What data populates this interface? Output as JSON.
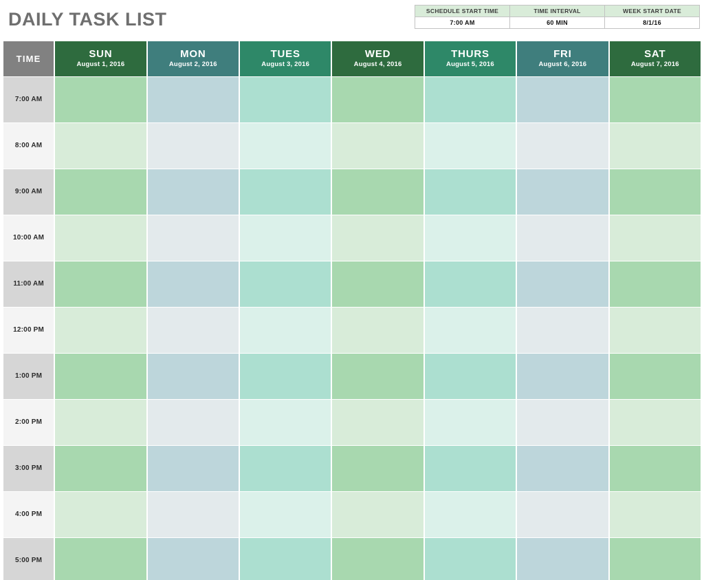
{
  "page_title": "DAILY TASK LIST",
  "settings": {
    "headers": [
      "SCHEDULE START TIME",
      "TIME INTERVAL",
      "WEEK START DATE"
    ],
    "values": [
      "7:00 AM",
      "60 MIN",
      "8/1/16"
    ]
  },
  "grid": {
    "time_header": "TIME",
    "days": [
      {
        "abbr": "SUN",
        "date": "August 1, 2016",
        "theme": "green"
      },
      {
        "abbr": "MON",
        "date": "August 2, 2016",
        "theme": "teal"
      },
      {
        "abbr": "TUES",
        "date": "August 3, 2016",
        "theme": "emerald"
      },
      {
        "abbr": "WED",
        "date": "August 4, 2016",
        "theme": "green"
      },
      {
        "abbr": "THURS",
        "date": "August 5, 2016",
        "theme": "emerald"
      },
      {
        "abbr": "FRI",
        "date": "August 6, 2016",
        "theme": "teal"
      },
      {
        "abbr": "SAT",
        "date": "August 7, 2016",
        "theme": "green"
      }
    ],
    "time_slots": [
      "7:00 AM",
      "8:00 AM",
      "9:00 AM",
      "10:00 AM",
      "11:00 AM",
      "12:00 PM",
      "1:00 PM",
      "2:00 PM",
      "3:00 PM",
      "4:00 PM",
      "5:00 PM"
    ],
    "cell_values": [
      [
        "",
        "",
        "",
        "",
        "",
        "",
        ""
      ],
      [
        "",
        "",
        "",
        "",
        "",
        "",
        ""
      ],
      [
        "",
        "",
        "",
        "",
        "",
        "",
        ""
      ],
      [
        "",
        "",
        "",
        "",
        "",
        "",
        ""
      ],
      [
        "",
        "",
        "",
        "",
        "",
        "",
        ""
      ],
      [
        "",
        "",
        "",
        "",
        "",
        "",
        ""
      ],
      [
        "",
        "",
        "",
        "",
        "",
        "",
        ""
      ],
      [
        "",
        "",
        "",
        "",
        "",
        "",
        ""
      ],
      [
        "",
        "",
        "",
        "",
        "",
        "",
        ""
      ],
      [
        "",
        "",
        "",
        "",
        "",
        "",
        ""
      ],
      [
        "",
        "",
        "",
        "",
        "",
        "",
        ""
      ]
    ]
  },
  "colors": {
    "title": "#6f6f6f",
    "time_header_bg": "#818181",
    "header_green": "#2e6b3e",
    "header_teal": "#3f7e7d",
    "header_emerald": "#2e8868",
    "band_green_dark": "#a8d8af",
    "band_green_light": "#d8ecd9",
    "band_teal_dark": "#bdd6db",
    "band_teal_light": "#e3eaec",
    "band_emerald_dark": "#acdfd0",
    "band_emerald_light": "#dbf1ea",
    "settings_header_bg": "#d9ecd9"
  }
}
